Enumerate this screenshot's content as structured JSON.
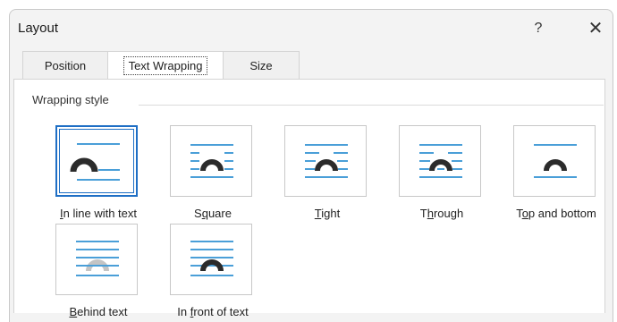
{
  "dialog": {
    "title": "Layout",
    "help_label": "?",
    "close_label": "✕"
  },
  "tabs": [
    {
      "label": "Position"
    },
    {
      "label": "Text Wrapping"
    },
    {
      "label": "Size"
    }
  ],
  "wrapping": {
    "group_label": "Wrapping style",
    "options": [
      {
        "label_key": "I",
        "label_rest": "n line with text",
        "icon": "in-line-with-text-icon"
      },
      {
        "label_pre": "S",
        "label_key": "q",
        "label_rest": "uare",
        "icon": "square-wrap-icon"
      },
      {
        "label_key": "T",
        "label_rest": "ight",
        "icon": "tight-wrap-icon"
      },
      {
        "label_pre": "T",
        "label_key": "h",
        "label_rest": "rough",
        "icon": "through-wrap-icon"
      },
      {
        "label_pre": "T",
        "label_key": "o",
        "label_rest": "p and bottom",
        "icon": "top-and-bottom-icon"
      },
      {
        "label_key": "B",
        "label_rest": "ehind text",
        "icon": "behind-text-icon"
      },
      {
        "label_pre": "In ",
        "label_key": "f",
        "label_rest": "ront of text",
        "icon": "in-front-of-text-icon"
      }
    ],
    "selected_index": 0
  },
  "colors": {
    "text_lines": "#4a9fd8",
    "arch": "#2b2b2b",
    "selection": "#1f6fc5"
  }
}
